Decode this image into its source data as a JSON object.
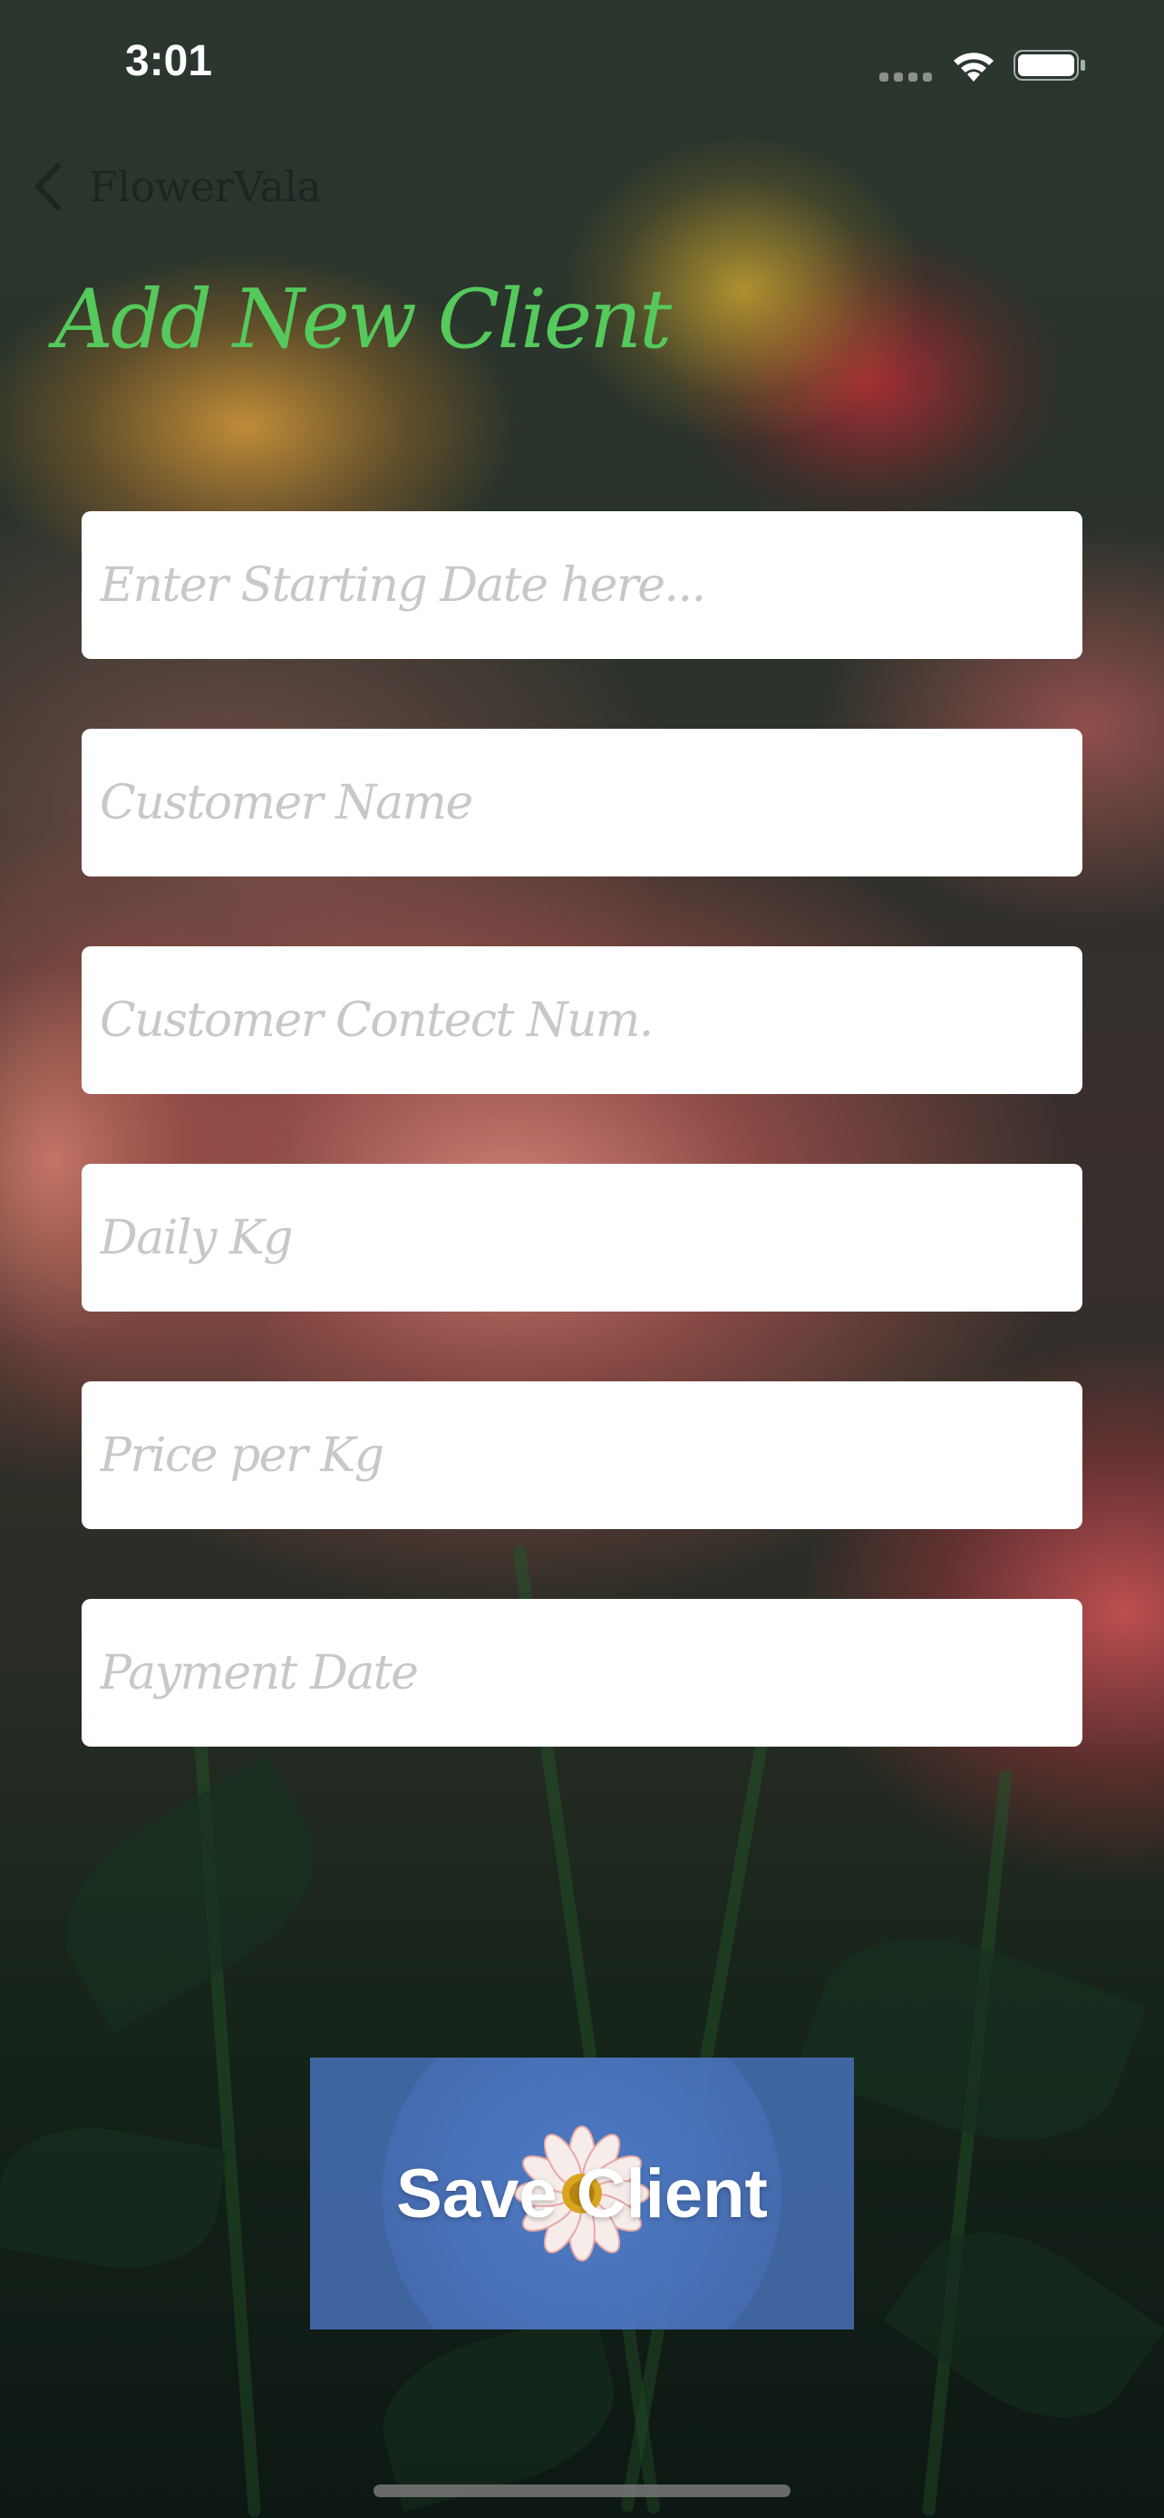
{
  "status_bar": {
    "time": "3:01",
    "icons": [
      "signal-icon",
      "wifi-icon",
      "battery-icon"
    ]
  },
  "nav": {
    "back_label": "FlowerVala",
    "back_icon": "chevron-left-icon"
  },
  "page": {
    "title": "Add New Client",
    "title_color": "#55c95c"
  },
  "form": {
    "fields": [
      {
        "placeholder": "Enter Starting Date here...",
        "value": ""
      },
      {
        "placeholder": "Customer Name",
        "value": ""
      },
      {
        "placeholder": "Customer Contect Num.",
        "value": ""
      },
      {
        "placeholder": "Daily Kg",
        "value": ""
      },
      {
        "placeholder": "Price per Kg",
        "value": ""
      },
      {
        "placeholder": "Payment Date",
        "value": ""
      }
    ]
  },
  "save_button": {
    "label": "Save Client",
    "icon": "flower-icon",
    "color": "#466eb4"
  }
}
